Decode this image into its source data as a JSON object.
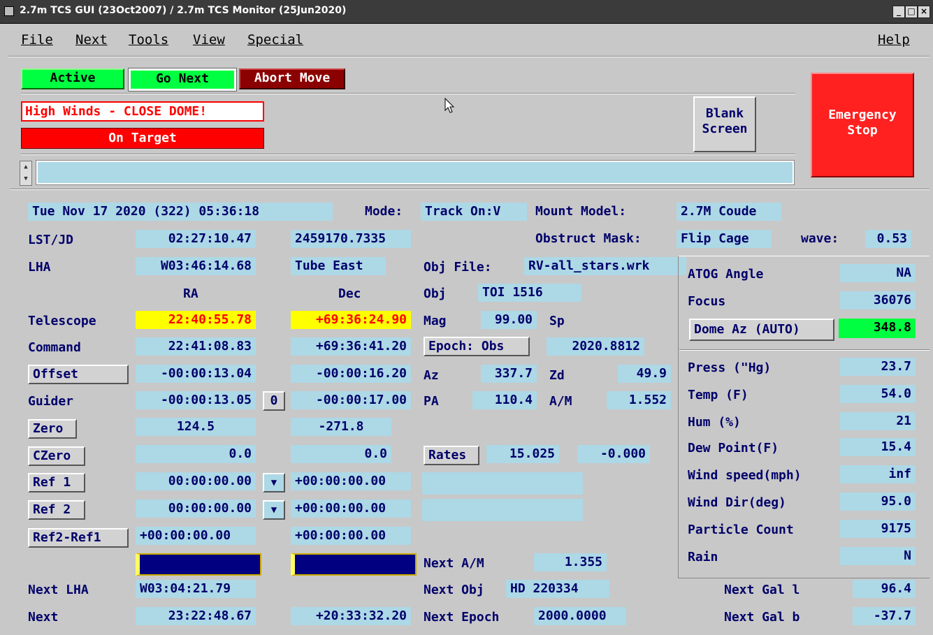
{
  "window": {
    "title": "2.7m TCS GUI (23Oct2007) / 2.7m TCS Monitor (25Jun2020)"
  },
  "menubar": {
    "file": "File",
    "next": "Next",
    "tools": "Tools",
    "view": "View",
    "special": "Special",
    "help": "Help"
  },
  "controls": {
    "active": "Active",
    "go_next": "Go Next",
    "abort_move": "Abort Move",
    "high_winds": "High Winds - CLOSE DOME!",
    "on_target": "On Target",
    "blank_screen_1": "Blank",
    "blank_screen_2": "Screen",
    "emergency_1": "Emergency",
    "emergency_2": "Stop",
    "command_input": ""
  },
  "status": {
    "datetime": "Tue Nov 17 2020 (322) 05:36:18",
    "mode_label": "Mode:",
    "mode": "Track On:V",
    "mount_model_label": "Mount Model:",
    "mount_model": "2.7M Coude",
    "obstruct_label": "Obstruct Mask:",
    "obstruct": "Flip Cage",
    "wave_label": "wave:",
    "wave": "0.53"
  },
  "labels": {
    "lst_jd": "LST/JD",
    "lha": "LHA",
    "ra": "RA",
    "dec": "Dec",
    "telescope": "Telescope",
    "command": "Command",
    "offset": "Offset",
    "guider": "Guider",
    "zero": "Zero",
    "czero": "CZero",
    "ref1": "Ref 1",
    "ref2": "Ref 2",
    "ref2ref1": "Ref2-Ref1",
    "next_lha": "Next LHA",
    "next": "Next",
    "obj_file": "Obj File:",
    "obj": "Obj",
    "mag": "Mag",
    "sp": "Sp",
    "epoch": "Epoch: Obs",
    "az": "Az",
    "zd": "Zd",
    "pa": "PA",
    "am": "A/M",
    "rates": "Rates",
    "next_am": "Next A/M",
    "next_obj": "Next Obj",
    "next_epoch": "Next Epoch",
    "next_gal_l": "Next Gal l",
    "next_gal_b": "Next Gal b",
    "guider_zero_btn": "0"
  },
  "values": {
    "lst": "02:27:10.47",
    "jd": "2459170.7335",
    "lha": "W03:46:14.68",
    "tube": "Tube East",
    "tel_ra": "22:40:55.78",
    "tel_dec": "+69:36:24.90",
    "cmd_ra": "22:41:08.83",
    "cmd_dec": "+69:36:41.20",
    "off_ra": "-00:00:13.04",
    "off_dec": "-00:00:16.20",
    "gui_ra": "-00:00:13.05",
    "gui_dec": "-00:00:17.00",
    "zero_ra": "124.5",
    "zero_dec": "-271.8",
    "czero_ra": "0.0",
    "czero_dec": "0.0",
    "ref1_ra": "00:00:00.00",
    "ref1_dec": "+00:00:00.00",
    "ref2_ra": "00:00:00.00",
    "ref2_dec": "+00:00:00.00",
    "r21_ra": "+00:00:00.00",
    "r21_dec": "+00:00:00.00",
    "next_lha": "W03:04:21.79",
    "next_ra": "23:22:48.67",
    "next_dec": "+20:33:32.20",
    "obj_file": "RV-all_stars.wrk",
    "obj": "TOI 1516",
    "mag": "99.00",
    "sp": "",
    "epoch": "2020.8812",
    "az": "337.7",
    "zd": "49.9",
    "pa": "110.4",
    "am": "1.552",
    "rate_ra": "15.025",
    "rate_dec": "-0.000",
    "next_am": "1.355",
    "next_obj": "HD 220334",
    "next_epoch": "2000.0000",
    "next_gal_l": "96.4",
    "next_gal_b": "-37.7"
  },
  "panel": {
    "atog_label": "ATOG Angle",
    "atog": "NA",
    "focus_label": "Focus",
    "focus": "36076",
    "dome_btn": "Dome Az (AUTO)",
    "dome": "348.8",
    "press_label": "Press (\"Hg)",
    "press": "23.7",
    "temp_label": "Temp (F)",
    "temp": "54.0",
    "hum_label": "Hum (%)",
    "hum": "21",
    "dew_label": "Dew Point(F)",
    "dew": "15.4",
    "wind_label": "Wind speed(mph)",
    "wind": "inf",
    "wdir_label": "Wind Dir(deg)",
    "wdir": "95.0",
    "part_label": "Particle Count",
    "part": "9175",
    "rain_label": "Rain",
    "rain": "N"
  },
  "colors": {
    "field": "#add8e6",
    "text": "#00006a",
    "green": "#00ff40",
    "red": "#ff0000",
    "darkred": "#8b0000",
    "yellow": "#ffff00",
    "navy": "#000080"
  }
}
